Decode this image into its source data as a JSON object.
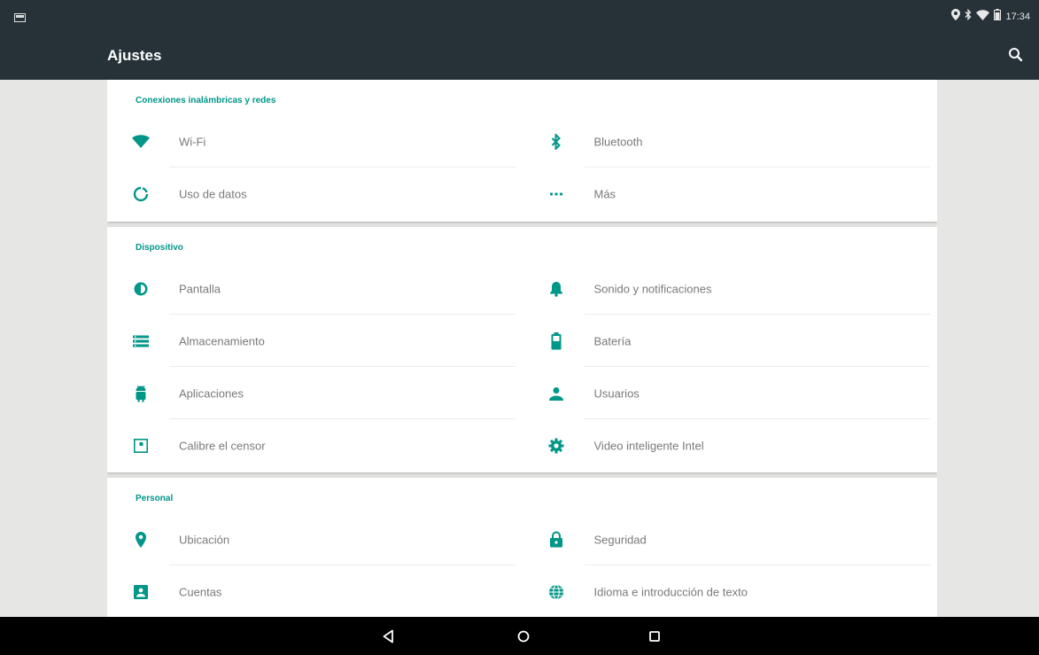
{
  "status_bar": {
    "time": "17:34",
    "icons": [
      "notification-icon",
      "location-icon",
      "bluetooth-icon",
      "wifi-icon",
      "battery-icon"
    ]
  },
  "app_bar": {
    "title": "Ajustes",
    "search_icon": "search-icon"
  },
  "sections": [
    {
      "header": "Conexiones inalámbricas y redes",
      "items": [
        {
          "label": "Wi-Fi",
          "icon": "wifi-icon"
        },
        {
          "label": "Bluetooth",
          "icon": "bluetooth-icon"
        },
        {
          "label": "Uso de datos",
          "icon": "data-usage-icon"
        },
        {
          "label": "Más",
          "icon": "more-icon"
        }
      ]
    },
    {
      "header": "Dispositivo",
      "items": [
        {
          "label": "Pantalla",
          "icon": "brightness-icon"
        },
        {
          "label": "Sonido y notificaciones",
          "icon": "bell-icon"
        },
        {
          "label": "Almacenamiento",
          "icon": "storage-icon"
        },
        {
          "label": "Batería",
          "icon": "battery-icon"
        },
        {
          "label": "Aplicaciones",
          "icon": "android-icon"
        },
        {
          "label": "Usuarios",
          "icon": "user-icon"
        },
        {
          "label": "Calibre el censor",
          "icon": "calibrate-icon"
        },
        {
          "label": "Video inteligente Intel",
          "icon": "gear-icon"
        }
      ]
    },
    {
      "header": "Personal",
      "items": [
        {
          "label": "Ubicación",
          "icon": "location-pin-icon"
        },
        {
          "label": "Seguridad",
          "icon": "lock-icon"
        },
        {
          "label": "Cuentas",
          "icon": "account-box-icon"
        },
        {
          "label": "Idioma e introducción de texto",
          "icon": "globe-icon"
        }
      ]
    }
  ],
  "nav_bar": {
    "buttons": [
      "back-icon",
      "home-icon",
      "recents-icon"
    ]
  },
  "colors": {
    "toolbar": "#263238",
    "accent": "#009688",
    "background": "#e6e6e4",
    "card": "#ffffff"
  }
}
